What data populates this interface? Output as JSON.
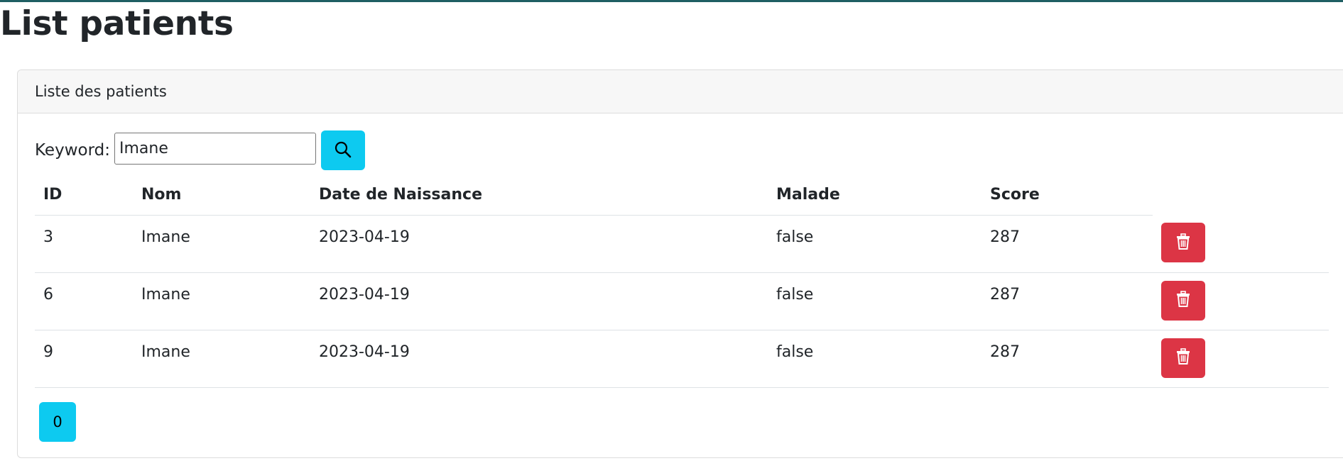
{
  "page": {
    "title": "List patients"
  },
  "card": {
    "header": "Liste des patients"
  },
  "search": {
    "label": "Keyword:",
    "value": "Imane",
    "button_icon": "search-icon",
    "button_color": "#0dcaf0"
  },
  "table": {
    "columns": [
      "ID",
      "Nom",
      "Date de Naissance",
      "Malade",
      "Score"
    ],
    "rows": [
      {
        "id": "3",
        "nom": "Imane",
        "date": "2023-04-19",
        "malade": "false",
        "score": "287"
      },
      {
        "id": "6",
        "nom": "Imane",
        "date": "2023-04-19",
        "malade": "false",
        "score": "287"
      },
      {
        "id": "9",
        "nom": "Imane",
        "date": "2023-04-19",
        "malade": "false",
        "score": "287"
      }
    ],
    "delete_icon": "trash-icon",
    "delete_color": "#dc3545"
  },
  "pagination": {
    "pages": [
      "0"
    ],
    "active_color": "#0dcaf0"
  },
  "colors": {
    "topbar": "#1f5f63",
    "card_header_bg": "#f7f7f7"
  }
}
